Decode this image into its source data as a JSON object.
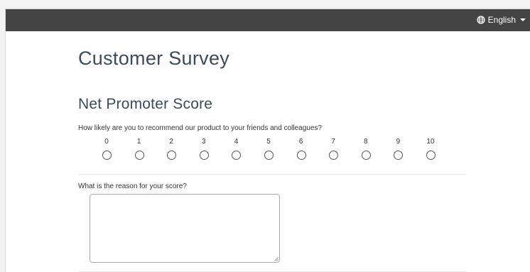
{
  "header": {
    "language_label": "English",
    "icons": {
      "globe": "globe-icon",
      "caret": "caret-down-icon"
    }
  },
  "survey": {
    "title": "Customer Survey",
    "section_title": "Net Promoter Score",
    "question1": "How likely are you to recommend our product to your friends and colleagues?",
    "scale": [
      "0",
      "1",
      "2",
      "3",
      "4",
      "5",
      "6",
      "7",
      "8",
      "9",
      "10"
    ],
    "question2": "What is the reason for your score?",
    "answer_value": ""
  },
  "colors": {
    "topbar": "#444444",
    "heading": "#3a4b5c",
    "text": "#333333"
  }
}
